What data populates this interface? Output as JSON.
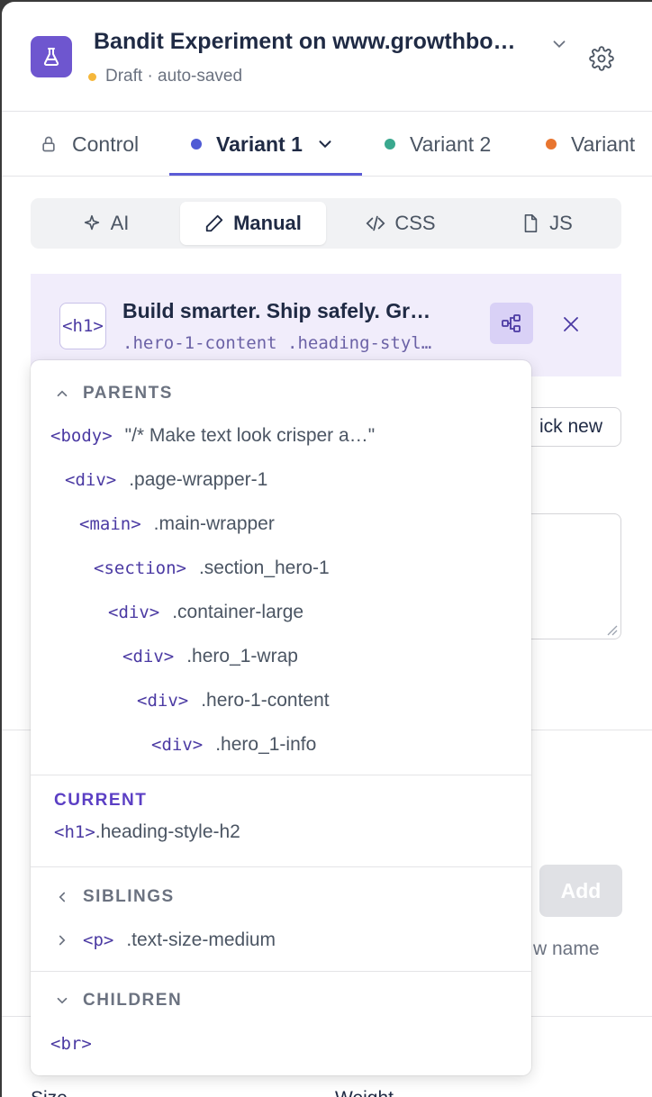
{
  "header": {
    "title": "Bandit Experiment on www.growthbo…",
    "status": "Draft · auto-saved"
  },
  "tabs": [
    {
      "label": "Control",
      "color": "#6b7280"
    },
    {
      "label": "Variant 1",
      "color": "#4f5bd5",
      "active": true
    },
    {
      "label": "Variant 2",
      "color": "#3aa88e"
    },
    {
      "label": "Variant",
      "color": "#e8752f"
    }
  ],
  "modes": [
    {
      "label": "AI",
      "icon": "sparkle-icon"
    },
    {
      "label": "Manual",
      "icon": "pencil-icon",
      "active": true
    },
    {
      "label": "CSS",
      "icon": "code-icon"
    },
    {
      "label": "JS",
      "icon": "js-file-icon"
    }
  ],
  "selected": {
    "tag": "<h1>",
    "title": "Build smarter. Ship safely. Gr…",
    "classes": ".hero-1-content .heading-styl…"
  },
  "background": {
    "pick_new": "ick new",
    "add": "Add",
    "hint": "w name",
    "size_label": "Size",
    "weight_label": "Weight"
  },
  "popover": {
    "parents_label": "PARENTS",
    "parents": [
      {
        "tag": "<body>",
        "value": "\"/* Make text look crisper a…\""
      },
      {
        "tag": "<div>",
        "value": ".page-wrapper-1"
      },
      {
        "tag": "<main>",
        "value": ".main-wrapper"
      },
      {
        "tag": "<section>",
        "value": ".section_hero-1"
      },
      {
        "tag": "<div>",
        "value": ".container-large"
      },
      {
        "tag": "<div>",
        "value": ".hero_1-wrap"
      },
      {
        "tag": "<div>",
        "value": ".hero-1-content"
      },
      {
        "tag": "<div>",
        "value": ".hero_1-info"
      }
    ],
    "current_label": "CURRENT",
    "current": {
      "tag": "<h1>",
      "value": ".heading-style-h2"
    },
    "siblings_label": "SIBLINGS",
    "siblings": [
      {
        "tag": "<p>",
        "value": ".text-size-medium"
      }
    ],
    "children_label": "CHILDREN",
    "children": [
      {
        "tag": "<br>",
        "value": ""
      }
    ]
  }
}
